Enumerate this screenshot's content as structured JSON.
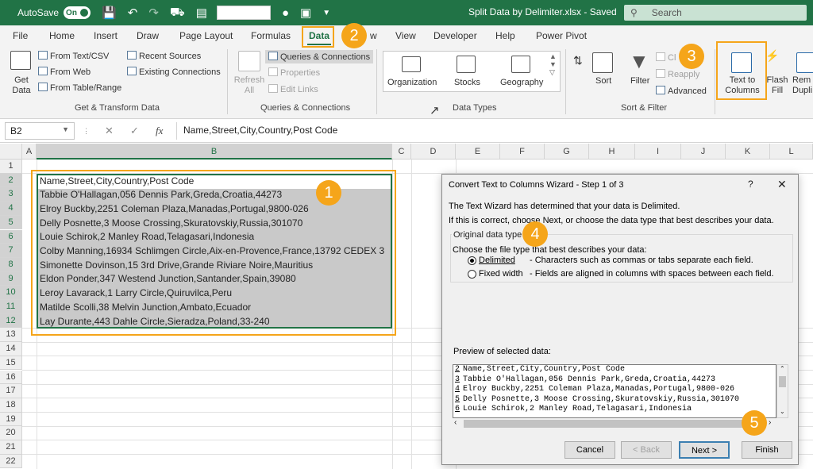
{
  "titlebar": {
    "autosave_label": "AutoSave",
    "autosave_state": "On",
    "title": "Split Data by Delimiter.xlsx  -  Saved",
    "search_label": "Search"
  },
  "tabs": [
    "File",
    "Home",
    "Insert",
    "Draw",
    "Page Layout",
    "Formulas",
    "Data",
    "w",
    "View",
    "Developer",
    "Help",
    "Power Pivot"
  ],
  "ribbon": {
    "get_data": "Get Data",
    "from_text_csv": "From Text/CSV",
    "from_web": "From Web",
    "from_table": "From Table/Range",
    "recent_sources": "Recent Sources",
    "existing_connections": "Existing Connections",
    "get_transform_label": "Get & Transform Data",
    "refresh_all": "Refresh All",
    "queries_connections": "Queries & Connections",
    "properties": "Properties",
    "edit_links": "Edit Links",
    "queries_label": "Queries & Connections",
    "organization": "Organization",
    "stocks": "Stocks",
    "geography": "Geography",
    "data_types_label": "Data Types",
    "sort": "Sort",
    "filter": "Filter",
    "clear": "Cl",
    "reapply": "Reapply",
    "advanced": "Advanced",
    "sort_filter_label": "Sort & Filter",
    "text_to_columns": "Text to Columns",
    "flash_fill": "Flash Fill",
    "remove_dup": "Rem Dupli"
  },
  "formulabar": {
    "namebox": "B2",
    "fx": "fx",
    "formula": "Name,Street,City,Country,Post Code"
  },
  "grid": {
    "columns": [
      "A",
      "B",
      "C",
      "D",
      "E",
      "F",
      "G",
      "H",
      "I",
      "J",
      "K",
      "L"
    ],
    "rows": [
      "1",
      "2",
      "3",
      "4",
      "5",
      "6",
      "7",
      "8",
      "9",
      "10",
      "11",
      "12",
      "13",
      "14",
      "15",
      "16",
      "17",
      "18",
      "19",
      "20",
      "21",
      "22"
    ],
    "cells": [
      "Name,Street,City,Country,Post Code",
      "Tabbie O'Hallagan,056 Dennis Park,Greda,Croatia,44273",
      "Elroy Buckby,2251 Coleman Plaza,Manadas,Portugal,9800-026",
      "Delly Posnette,3 Moose Crossing,Skuratovskiy,Russia,301070",
      "Louie Schirok,2 Manley Road,Telagasari,Indonesia",
      "Colby Manning,16934 Schlimgen Circle,Aix-en-Provence,France,13792 CEDEX 3",
      "Simonette Dovinson,15 3rd Drive,Grande Riviare Noire,Mauritius",
      "Eldon Ponder,347 Westend Junction,Santander,Spain,39080",
      "Leroy Lavarack,1 Larry Circle,Quiruvilca,Peru",
      "Matilde Scolli,38 Melvin Junction,Ambato,Ecuador",
      "Lay Durante,443 Dahle Circle,Sieradza,Poland,33-240"
    ]
  },
  "badges": [
    "1",
    "2",
    "3",
    "4",
    "5"
  ],
  "dialog": {
    "title": "Convert Text to Columns Wizard - Step 1 of 3",
    "help": "?",
    "close": "✕",
    "line1": "The Text Wizard has determined that your data is Delimited.",
    "line2": "If this is correct, choose Next, or choose the data type that best describes your data.",
    "legend": "Original data type",
    "choose": "Choose the file type that best describes your data:",
    "delimited": "Delimited",
    "delimited_desc": "- Characters such as commas or tabs separate each field.",
    "fixed": "Fixed width",
    "fixed_desc": "- Fields are aligned in columns with spaces between each field.",
    "preview_label": "Preview of selected data:",
    "preview": [
      {
        "n": "2",
        "t": "Name,Street,City,Country,Post Code"
      },
      {
        "n": "3",
        "t": "Tabbie O'Hallagan,056 Dennis Park,Greda,Croatia,44273"
      },
      {
        "n": "4",
        "t": "Elroy Buckby,2251 Coleman Plaza,Manadas,Portugal,9800-026"
      },
      {
        "n": "5",
        "t": "Delly Posnette,3 Moose Crossing,Skuratovskiy,Russia,301070"
      },
      {
        "n": "6",
        "t": "Louie Schirok,2 Manley Road,Telagasari,Indonesia"
      }
    ],
    "cancel": "Cancel",
    "back": "< Back",
    "next": "Next >",
    "finish": "Finish"
  },
  "colors": {
    "excel_green": "#217346",
    "callout_orange": "#f5a51a"
  }
}
